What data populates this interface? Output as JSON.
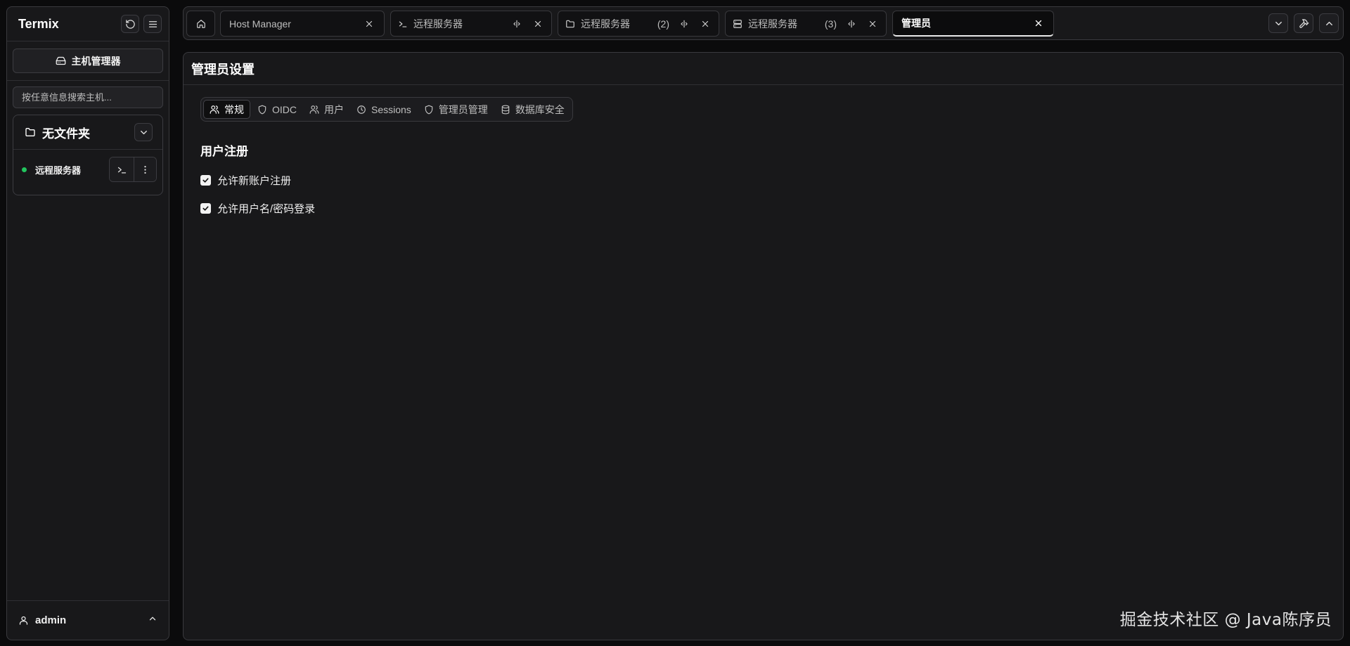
{
  "sidebar": {
    "app_title": "Termix",
    "host_manager_label": "主机管理器",
    "search_placeholder": "按任意信息搜索主机...",
    "folder": {
      "name": "无文件夹",
      "hosts": [
        {
          "name": "远程服务器",
          "status": "online",
          "status_color": "#22c55e"
        }
      ]
    },
    "user": {
      "name": "admin"
    }
  },
  "tabs": [
    {
      "label": "Host Manager",
      "icon": "none"
    },
    {
      "label": "远程服务器",
      "icon": "terminal-icon",
      "number": ""
    },
    {
      "label": "远程服务器",
      "icon": "folder-icon",
      "number": "(2)"
    },
    {
      "label": "远程服务器",
      "icon": "server-icon",
      "number": "(3)"
    },
    {
      "label": "管理员",
      "icon": "none",
      "active": true
    }
  ],
  "main": {
    "title": "管理员设置",
    "subtabs": [
      {
        "label": "常规",
        "icon": "users-icon",
        "active": true
      },
      {
        "label": "OIDC",
        "icon": "shield-icon"
      },
      {
        "label": "用户",
        "icon": "users-icon"
      },
      {
        "label": "Sessions",
        "icon": "clock-icon"
      },
      {
        "label": "管理员管理",
        "icon": "shield-icon"
      },
      {
        "label": "数据库安全",
        "icon": "database-icon"
      }
    ],
    "section_title": "用户注册",
    "options": [
      {
        "label": "允许新账户注册",
        "checked": true
      },
      {
        "label": "允许用户名/密码登录",
        "checked": true
      }
    ]
  },
  "watermark": "掘金技术社区 @ Java陈序员"
}
